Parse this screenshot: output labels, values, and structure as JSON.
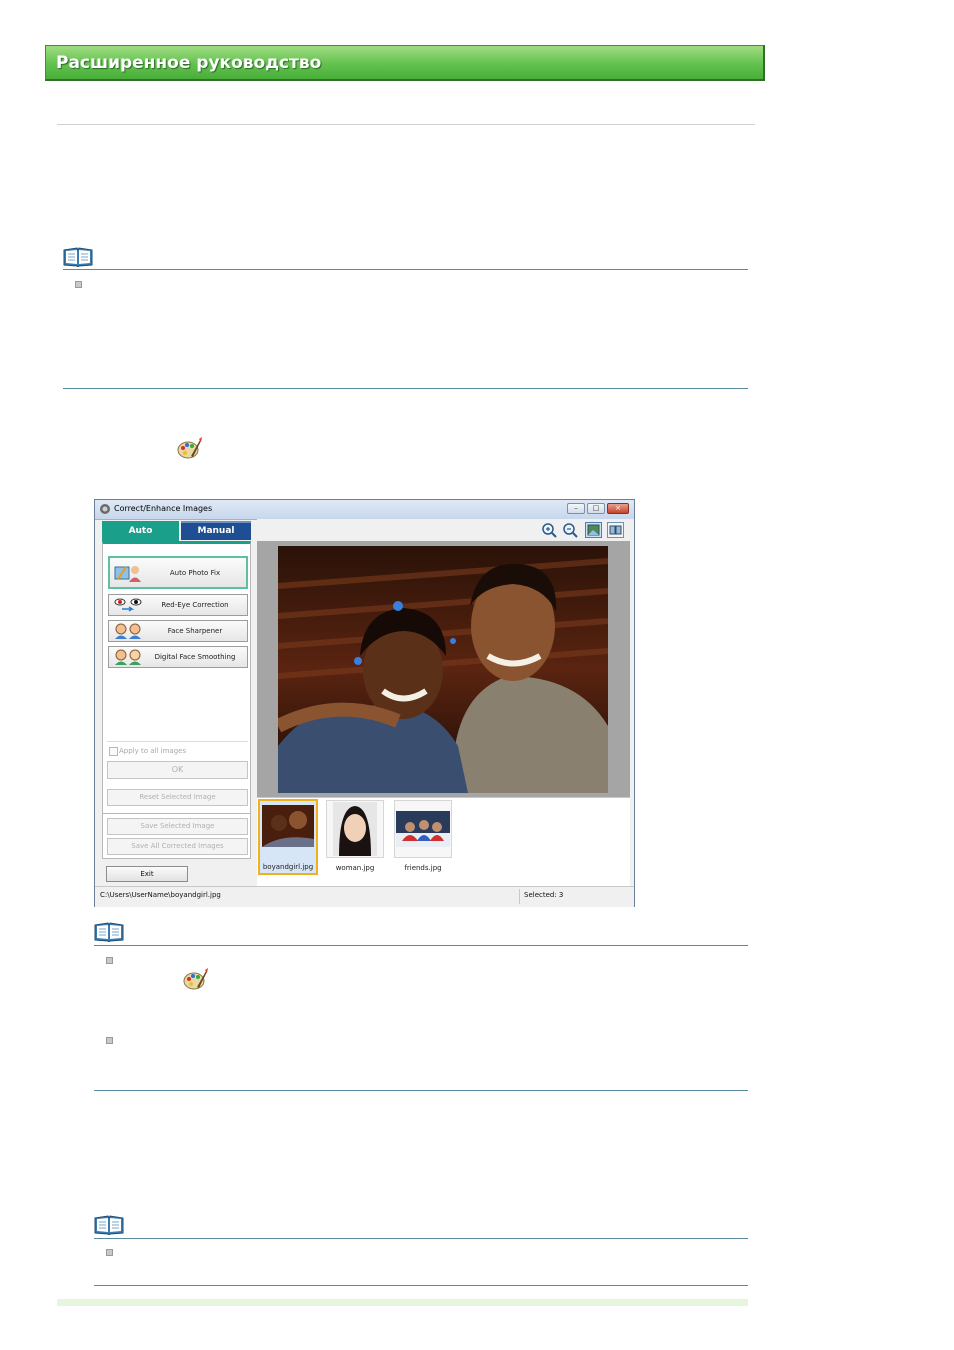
{
  "banner": {
    "title": "Расширенное руководство"
  },
  "window": {
    "title": "Correct/Enhance Images",
    "tabs": {
      "auto": "Auto",
      "manual": "Manual"
    },
    "functions": {
      "auto_photo_fix": "Auto Photo Fix",
      "red_eye": "Red-Eye Correction",
      "face_sharpener": "Face Sharpener",
      "face_smoothing": "Digital Face Smoothing"
    },
    "apply_all": "Apply to all images",
    "ok": "OK",
    "reset": "Reset Selected Image",
    "save_selected": "Save Selected Image",
    "save_all": "Save All Corrected Images",
    "exit": "Exit",
    "thumbnails": [
      "boyandgirl.jpg",
      "woman.jpg",
      "friends.jpg"
    ],
    "status_path": "C:\\Users\\UserName\\boyandgirl.jpg",
    "status_selected": "Selected: 3"
  },
  "colors": {
    "banner_green": "#5cbf4a",
    "tab_auto": "#1aa08a",
    "tab_manual": "#1e4f93",
    "note_rule": "#5a8aa0"
  },
  "icons": [
    "note-book-icon",
    "palette-icon",
    "zoom-in-icon",
    "zoom-out-icon",
    "full-view-icon",
    "compare-view-icon"
  ]
}
